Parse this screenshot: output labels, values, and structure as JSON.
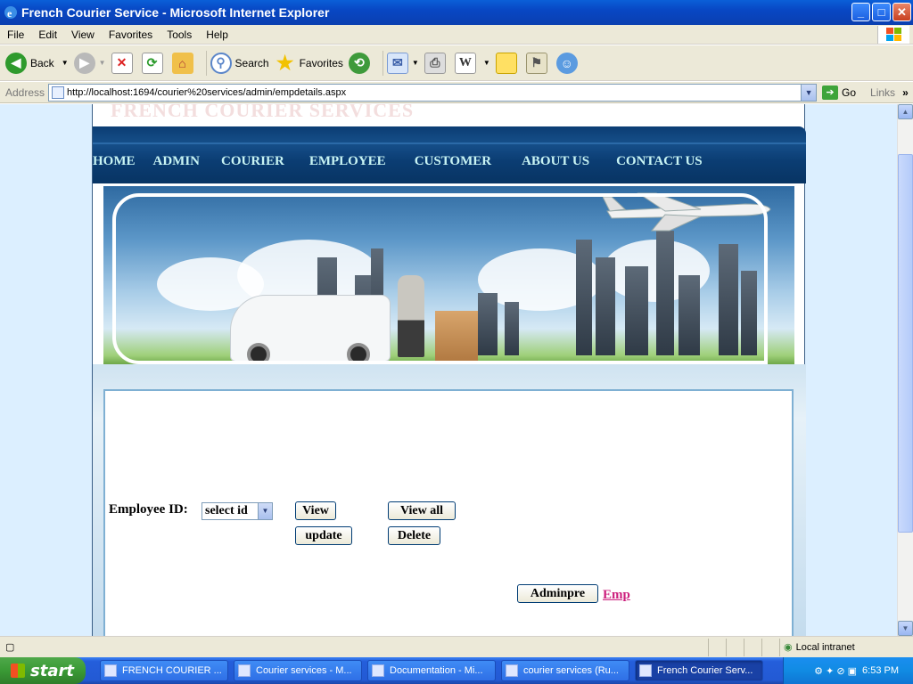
{
  "window": {
    "title": "French Courier Service - Microsoft Internet Explorer",
    "minimize": "_",
    "maximize": "□",
    "close": "✕"
  },
  "menu": [
    "File",
    "Edit",
    "View",
    "Favorites",
    "Tools",
    "Help"
  ],
  "toolbar": {
    "back": "Back",
    "search": "Search",
    "favorites": "Favorites"
  },
  "address": {
    "label": "Address",
    "url": "http://localhost:1694/courier%20services/admin/empdetails.aspx",
    "go": "Go",
    "links": "Links"
  },
  "site": {
    "logo_text": "FRENCH COURIER SERVICES",
    "nav": [
      "HOME",
      "ADMIN",
      "COURIER",
      "EMPLOYEE",
      "CUSTOMER",
      "ABOUT US",
      "CONTACT US"
    ]
  },
  "form": {
    "employee_id_label": "Employee ID:",
    "select_value": "select id",
    "view": "View",
    "view_all": "View all",
    "update": "update",
    "delete": "Delete",
    "adminpre": "Adminpre",
    "emp_link": "Emp"
  },
  "status": {
    "zone": "Local intranet"
  },
  "taskbar": {
    "start": "start",
    "tasks": [
      "FRENCH COURIER ...",
      "Courier services - M...",
      "Documentation - Mi...",
      "courier services (Ru...",
      "French Courier Serv..."
    ],
    "clock": "6:53 PM"
  }
}
